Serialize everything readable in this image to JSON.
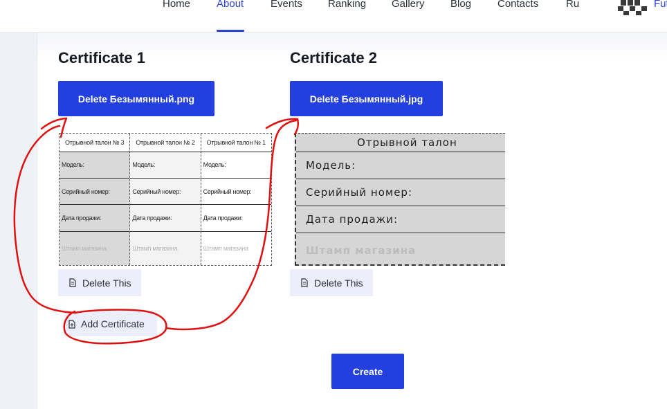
{
  "nav": {
    "items": [
      {
        "label": "Home"
      },
      {
        "label": "About"
      },
      {
        "label": "Events"
      },
      {
        "label": "Ranking"
      },
      {
        "label": "Gallery"
      },
      {
        "label": "Blog"
      },
      {
        "label": "Contacts"
      },
      {
        "label": "Ru"
      }
    ],
    "active": "About",
    "brand_partial": "Fut"
  },
  "certificates": [
    {
      "title": "Certificate 1",
      "delete_file_label": "Delete Безымянный.png",
      "delete_this_label": "Delete This",
      "image": {
        "columns": [
          {
            "header": "Отрывной талон № 3",
            "rows": [
              "Модель:",
              "Серийный номер:",
              "Дата продажи:",
              "Штамп магазина"
            ]
          },
          {
            "header": "Отрывной талон № 2",
            "rows": [
              "Модель:",
              "Серийный номер:",
              "Дата продажи:",
              "Штамп магазина"
            ]
          },
          {
            "header": "Отрывной талон № 1",
            "rows": [
              "Модель:",
              "Серийный номер:",
              "Дата продажи:",
              "Штамп магазина"
            ]
          }
        ]
      }
    },
    {
      "title": "Certificate 2",
      "delete_file_label": "Delete Безымянный.jpg",
      "delete_this_label": "Delete This",
      "image": {
        "header": "Отрывной талон",
        "rows": [
          "Модель:",
          "Серийный номер:",
          "Дата продажи:",
          "Штамп магазина"
        ]
      }
    }
  ],
  "add_certificate_label": "Add Certificate",
  "create_label": "Create",
  "colors": {
    "primary": "#2340df",
    "soft_button": "#eceefa",
    "nav_active": "#2a44d8",
    "annotation": "#e01010"
  }
}
